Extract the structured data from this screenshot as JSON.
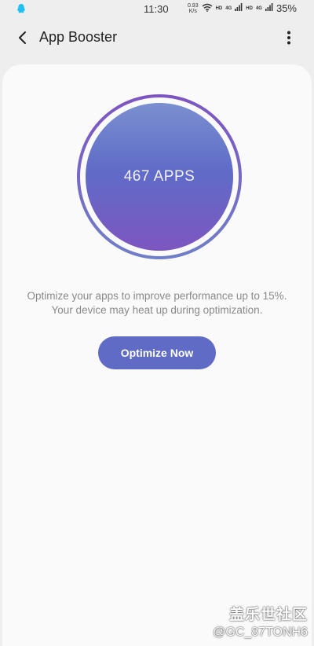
{
  "status_bar": {
    "time": "11:30",
    "net_speed_value": "0.93",
    "net_speed_unit": "K/s",
    "hd_label": "HD",
    "lte_label": "4G",
    "battery": "35%",
    "notification_icon": "qq-icon",
    "wifi_icon": "wifi-icon",
    "signal_icon": "signal-icon"
  },
  "header": {
    "title": "App Booster",
    "back_icon": "back-arrow-icon",
    "more_icon": "more-vert-icon"
  },
  "main": {
    "orb_text": "467 APPS",
    "description_line1": "Optimize your apps to improve performance up to 15%.",
    "description_line2": "Your device may heat up during optimization.",
    "button_label": "Optimize Now"
  },
  "watermark": {
    "line1": "盖乐世社区",
    "line2": "@GC_87TONH6"
  },
  "colors": {
    "accent": "#5f6bc5",
    "ring_top": "#7e53c2",
    "ring_bottom": "#6f7fc9",
    "background": "#eeeeee",
    "card": "#fafafa"
  }
}
